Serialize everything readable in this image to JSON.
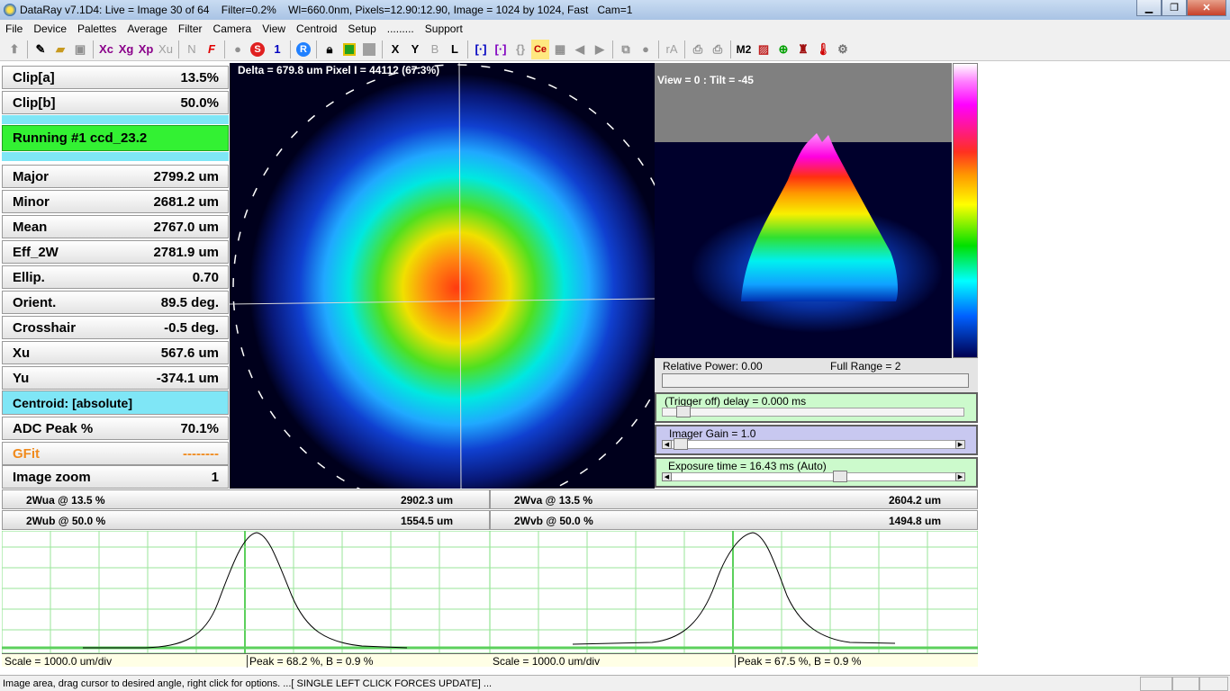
{
  "window": {
    "title": "DataRay v7.1D4: Live = Image 30 of 64    Filter=0.2%    Wl=660.0nm, Pixels=12.90:12.90, Image = 1024 by 1024, Fast   Cam=1"
  },
  "menu": [
    "File",
    "Device",
    "Palettes",
    "Average",
    "Filter",
    "Camera",
    "View",
    "Centroid",
    "Setup",
    ".........",
    "Support"
  ],
  "toolbar": {
    "xc": "Xc",
    "xg": "Xg",
    "xp": "Xp",
    "xu": "Xu",
    "n": "N",
    "f": "F",
    "s": "S",
    "one": "1",
    "r": "R",
    "x": "X",
    "y": "Y",
    "b": "B",
    "l": "L",
    "ra": "rA",
    "m2": "M2"
  },
  "params": {
    "clip_a": {
      "label": "Clip[a]",
      "value": "13.5%"
    },
    "clip_b": {
      "label": "Clip[b]",
      "value": "50.0%"
    },
    "running": "Running #1 ccd_23.2",
    "major": {
      "label": "Major",
      "value": "2799.2 um"
    },
    "minor": {
      "label": "Minor",
      "value": "2681.2 um"
    },
    "mean": {
      "label": "Mean",
      "value": "2767.0 um"
    },
    "eff_2w": {
      "label": "Eff_2W",
      "value": "2781.9 um"
    },
    "ellip": {
      "label": "Ellip.",
      "value": "0.70"
    },
    "orient": {
      "label": "Orient.",
      "value": "89.5 deg."
    },
    "crosshair": {
      "label": "Crosshair",
      "value": "-0.5 deg."
    },
    "xu": {
      "label": "Xu",
      "value": "567.6 um"
    },
    "yu": {
      "label": "Yu",
      "value": "-374.1 um"
    },
    "centroid": "Centroid: [absolute]",
    "adc_peak": {
      "label": "ADC Peak %",
      "value": "70.1%"
    },
    "gfit": {
      "label": "GFit",
      "value": "--------"
    },
    "image_zoom": {
      "label": "Image zoom",
      "value": "1"
    }
  },
  "image": {
    "delta": "Delta = 679.8 um Pixel I = 44112 (67.3%)"
  },
  "view3d": {
    "label": "View = 0 : Tilt = -45"
  },
  "controls": {
    "relative_power": "Relative Power: 0.00",
    "full_range": "Full Range = 2",
    "trigger": "(Trigger off) delay = 0.000 ms",
    "gain": "Imager Gain = 1.0",
    "exposure": "Exposure time = 16.43 ms (Auto)",
    "colors": {
      "trigger_bg": "#ccfacc",
      "gain_bg": "#c8c8f0",
      "exposure_bg": "#ccfacc"
    }
  },
  "profiles": {
    "u": {
      "wa_label": "2Wua @ 13.5 %",
      "wa_value": "2902.3 um",
      "wb_label": "2Wub @ 50.0 %",
      "wb_value": "1554.5 um",
      "scale": "Scale = 1000.0 um/div",
      "peak": "Peak = 68.2 %,  B = 0.9 %"
    },
    "v": {
      "wa_label": "2Wva @ 13.5 %",
      "wa_value": "2604.2 um",
      "wb_label": "2Wvb @ 50.0 %",
      "wb_value": "1494.8 um",
      "scale": "Scale = 1000.0 um/div",
      "peak": "Peak = 67.5 %,  B = 0.9 %"
    }
  },
  "status": {
    "message": "Image area, drag cursor to desired angle, right click for options.  ...[ SINGLE LEFT CLICK FORCES UPDATE] ..."
  }
}
